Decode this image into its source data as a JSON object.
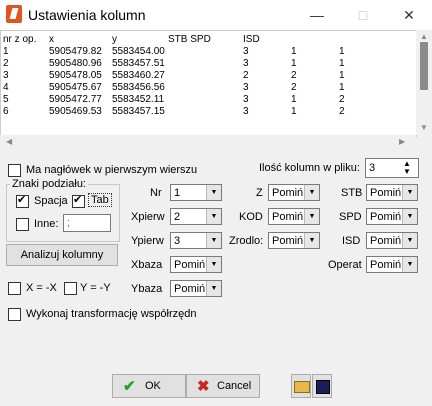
{
  "window": {
    "title": "Ustawienia kolumn",
    "minimize_icon": "minimize-icon",
    "maximize_icon": "maximize-icon",
    "close_icon": "close-icon"
  },
  "preview": {
    "headers": [
      "nr z op.",
      "x",
      "y",
      "STB SPD",
      "ISD"
    ],
    "rows": [
      [
        "1",
        "5905479.82",
        "5583454.00",
        "3",
        "1",
        "1"
      ],
      [
        "2",
        "5905480.96",
        "5583457.51",
        "3",
        "1",
        "1"
      ],
      [
        "3",
        "5905478.05",
        "5583460.27",
        "2",
        "2",
        "1"
      ],
      [
        "4",
        "5905475.67",
        "5583456.56",
        "3",
        "2",
        "1"
      ],
      [
        "5",
        "5905472.77",
        "5583452.11",
        "3",
        "1",
        "2"
      ],
      [
        "6",
        "5905469.53",
        "5583457.15",
        "3",
        "1",
        "2"
      ]
    ]
  },
  "options": {
    "header_row_label": "Ma nagłówek w pierwszym wierszu",
    "header_row_checked": false,
    "separators_title": "Znaki podziału:",
    "space_label": "Spacja",
    "space_checked": true,
    "tab_label": "Tab",
    "tab_checked": true,
    "other_label": "Inne:",
    "other_checked": false,
    "other_value": ";",
    "analyze_button": "Analizuj kolumny",
    "x_neg_label": "X = -X",
    "y_neg_label": "Y = -Y",
    "transform_label": "Wykonaj transformację współrzędn",
    "column_count_label": "Ilość kolumn w pliku:",
    "column_count_value": "3"
  },
  "fields": {
    "nr": {
      "label": "Nr",
      "value": "1"
    },
    "xpierw": {
      "label": "Xpierw",
      "value": "2"
    },
    "ypierw": {
      "label": "Ypierw",
      "value": "3"
    },
    "xbaza": {
      "label": "Xbaza",
      "value": "Pomiń"
    },
    "ybaza": {
      "label": "Ybaza",
      "value": "Pomiń"
    },
    "z": {
      "label": "Z",
      "value": "Pomiń"
    },
    "kod": {
      "label": "KOD",
      "value": "Pomiń"
    },
    "zrodlo": {
      "label": "Zrodlo:",
      "value": "Pomiń"
    },
    "stb": {
      "label": "STB",
      "value": "Pomiń"
    },
    "spd": {
      "label": "SPD",
      "value": "Pomiń"
    },
    "isd": {
      "label": "ISD",
      "value": "Pomiń"
    },
    "operat": {
      "label": "Operat",
      "value": "Pomiń"
    }
  },
  "buttons": {
    "ok": "OK",
    "cancel": "Cancel"
  },
  "colors": {
    "accent": "#e2541d",
    "ok_check": "#2a9d2a",
    "cancel_x": "#c62828"
  }
}
